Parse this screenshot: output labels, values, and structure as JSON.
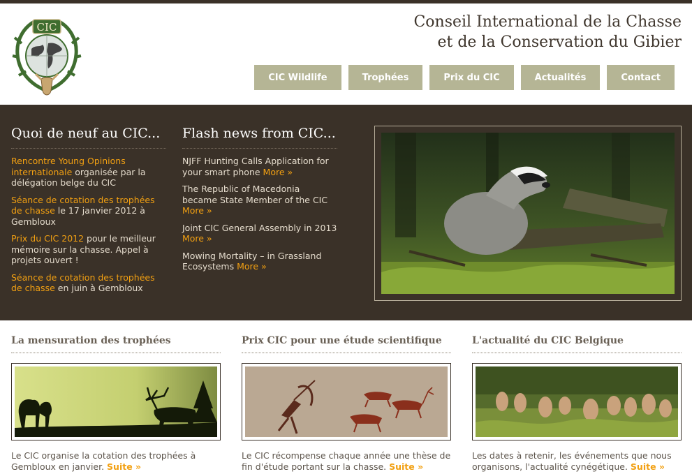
{
  "site": {
    "title_line1": "Conseil International de la Chasse",
    "title_line2": "et de la Conservation du Gibier",
    "logo_text": "CIC"
  },
  "nav": {
    "items": [
      {
        "label": "CIC Wildlife"
      },
      {
        "label": "Trophées"
      },
      {
        "label": "Prix du CIC"
      },
      {
        "label": "Actualités"
      },
      {
        "label": "Contact"
      }
    ]
  },
  "news": {
    "heading": "Quoi de neuf au CIC...",
    "items": [
      {
        "link": "Rencontre Young Opinions internationale",
        "text": " organisée par la délégation belge du CIC"
      },
      {
        "link": "Séance de cotation des trophées de chasse",
        "text": " le 17 janvier 2012 à Gembloux"
      },
      {
        "link": "Prix du CIC 2012",
        "text": " pour le meilleur mémoire sur la chasse. Appel à projets ouvert !"
      },
      {
        "link": "Séance de cotation des trophées de chasse",
        "text": " en juin à Gembloux"
      }
    ]
  },
  "flash": {
    "heading": "Flash news from CIC...",
    "more_label": "More »",
    "items": [
      {
        "text": "NJFF Hunting Calls Application for your smart phone "
      },
      {
        "text": "The Republic of Macedonia became State Member of the CIC "
      },
      {
        "text": "Joint CIC General Assembly in 2013 "
      },
      {
        "text": "Mowing Mortality – in Grassland Ecosystems "
      }
    ]
  },
  "features": [
    {
      "title": "La mensuration des trophées",
      "desc": "Le CIC organise la cotation des trophées à Gembloux en janvier. ",
      "link": "Suite »"
    },
    {
      "title": "Prix CIC pour une étude scientifique",
      "desc": "Le CIC récompense chaque année une thèse de fin d'étude portant sur la chasse. ",
      "link": "Suite »"
    },
    {
      "title": "L'actualité du CIC Belgique",
      "desc": "Les dates à retenir, les événements que nous organisons, l'actualité cynégétique. ",
      "link": "Suite »"
    }
  ],
  "colors": {
    "dark_band": "#3a3128",
    "nav_bg": "#b5b595",
    "accent_link": "#f2a012"
  }
}
